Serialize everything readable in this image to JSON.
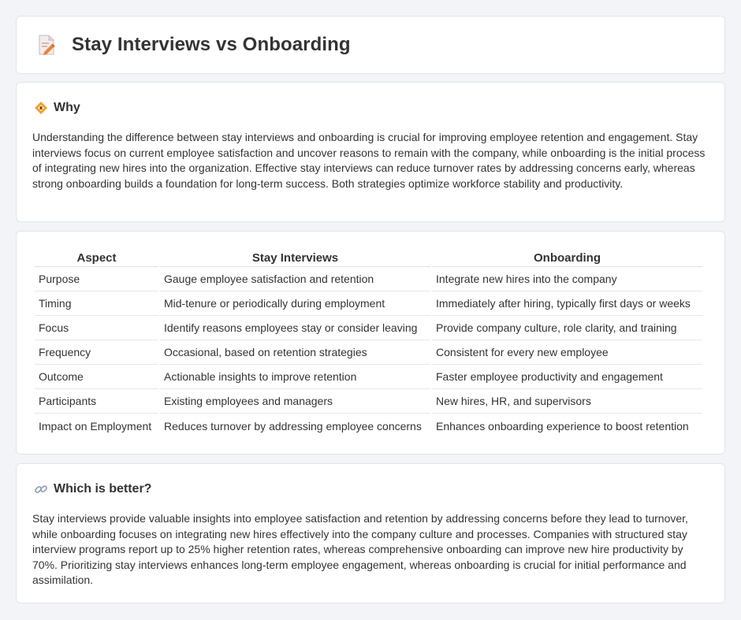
{
  "header": {
    "title": "Stay Interviews vs Onboarding",
    "icon": "document-pencil-icon"
  },
  "why": {
    "heading": "Why",
    "icon": "warning-diamond-icon",
    "text": "Understanding the difference between stay interviews and onboarding is crucial for improving employee retention and engagement. Stay interviews focus on current employee satisfaction and uncover reasons to remain with the company, while onboarding is the initial process of integrating new hires into the organization. Effective stay interviews can reduce turnover rates by addressing concerns early, whereas strong onboarding builds a foundation for long-term success. Both strategies optimize workforce stability and productivity."
  },
  "table": {
    "headers": [
      "Aspect",
      "Stay Interviews",
      "Onboarding"
    ],
    "rows": [
      [
        "Purpose",
        "Gauge employee satisfaction and retention",
        "Integrate new hires into the company"
      ],
      [
        "Timing",
        "Mid-tenure or periodically during employment",
        "Immediately after hiring, typically first days or weeks"
      ],
      [
        "Focus",
        "Identify reasons employees stay or consider leaving",
        "Provide company culture, role clarity, and training"
      ],
      [
        "Frequency",
        "Occasional, based on retention strategies",
        "Consistent for every new employee"
      ],
      [
        "Outcome",
        "Actionable insights to improve retention",
        "Faster employee productivity and engagement"
      ],
      [
        "Participants",
        "Existing employees and managers",
        "New hires, HR, and supervisors"
      ],
      [
        "Impact on Employment",
        "Reduces turnover by addressing employee concerns",
        "Enhances onboarding experience to boost retention"
      ]
    ]
  },
  "better": {
    "heading": "Which is better?",
    "icon": "link-icon",
    "text": "Stay interviews provide valuable insights into employee satisfaction and retention by addressing concerns before they lead to turnover, while onboarding focuses on integrating new hires effectively into the company culture and processes. Companies with structured stay interview programs report up to 25% higher retention rates, whereas comprehensive onboarding can improve new hire productivity by 70%. Prioritizing stay interviews enhances long-term employee engagement, whereas onboarding is crucial for initial performance and assimilation."
  },
  "colors": {
    "background": "#f2f4f8",
    "card": "#ffffff",
    "text": "#333333",
    "accent": "#e8833a"
  }
}
